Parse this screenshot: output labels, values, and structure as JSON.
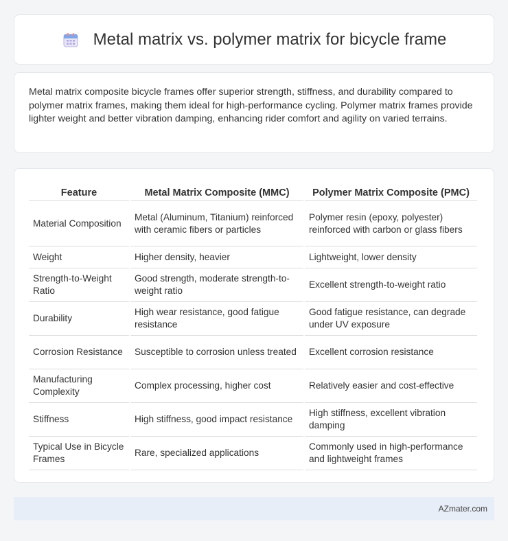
{
  "header": {
    "title": "Metal matrix vs. polymer matrix for bicycle frame",
    "icon": "calendar-icon"
  },
  "summary": "Metal matrix composite bicycle frames offer superior strength, stiffness, and durability compared to polymer matrix frames, making them ideal for high-performance cycling. Polymer matrix frames provide lighter weight and better vibration damping, enhancing rider comfort and agility on varied terrains.",
  "table": {
    "headers": [
      "Feature",
      "Metal Matrix Composite (MMC)",
      "Polymer Matrix Composite (PMC)"
    ],
    "rows": [
      [
        "Material Composition",
        "Metal (Aluminum, Titanium) reinforced with ceramic fibers or particles",
        "Polymer resin (epoxy, polyester) reinforced with carbon or glass fibers"
      ],
      [
        "Weight",
        "Higher density, heavier",
        "Lightweight, lower density"
      ],
      [
        "Strength-to-Weight Ratio",
        "Good strength, moderate strength-to-weight ratio",
        "Excellent strength-to-weight ratio"
      ],
      [
        "Durability",
        "High wear resistance, good fatigue resistance",
        "Good fatigue resistance, can degrade under UV exposure"
      ],
      [
        "Corrosion Resistance",
        "Susceptible to corrosion unless treated",
        "Excellent corrosion resistance"
      ],
      [
        "Manufacturing Complexity",
        "Complex processing, higher cost",
        "Relatively easier and cost-effective"
      ],
      [
        "Stiffness",
        "High stiffness, good impact resistance",
        "High stiffness, excellent vibration damping"
      ],
      [
        "Typical Use in Bicycle Frames",
        "Rare, specialized applications",
        "Commonly used in high-performance and lightweight frames"
      ]
    ]
  },
  "footer": {
    "site": "AZmater.com"
  }
}
